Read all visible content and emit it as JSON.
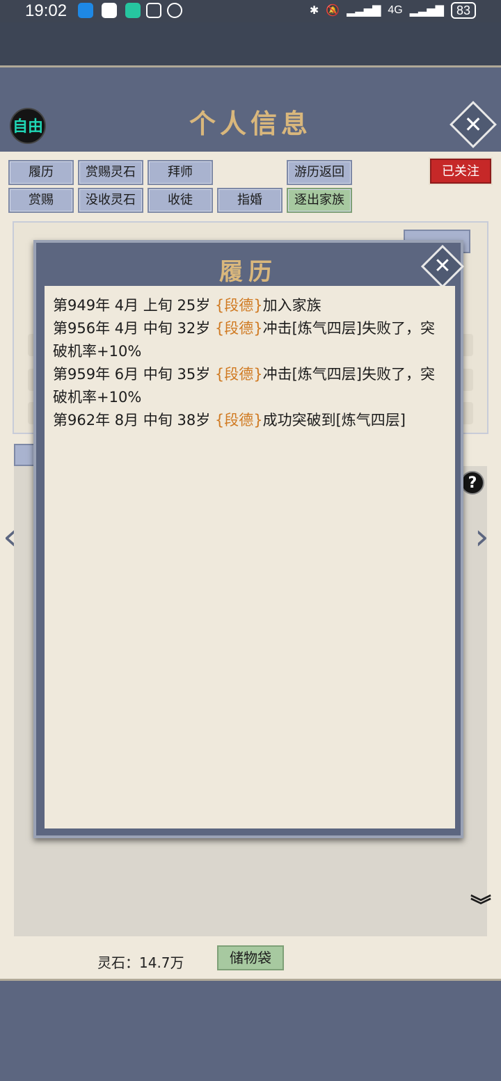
{
  "status_bar": {
    "time": "19:02",
    "network": "4G",
    "battery": "83"
  },
  "header": {
    "free_badge": "自由",
    "title": "个人信息"
  },
  "actions": {
    "row1": [
      "履历",
      "赏赐灵石",
      "拜师",
      "游历返回"
    ],
    "row2": [
      "赏赐",
      "没收灵石",
      "收徒",
      "指婚",
      "逐出家族"
    ],
    "followed": "已关注"
  },
  "bottom_bar": {
    "spirit_stone": "灵石：14.7万",
    "storage_bag": "储物袋"
  },
  "modal": {
    "title": "履历",
    "entries": [
      {
        "date": "第949年 4月 上旬  25岁 ",
        "name": "{段德}",
        "event": "加入家族"
      },
      {
        "date": "第956年 4月 中旬  32岁 ",
        "name": "{段德}",
        "event": "冲击[炼气四层]失败了，突破机率+10%"
      },
      {
        "date": "第959年 6月 中旬  35岁 ",
        "name": "{段德}",
        "event": "冲击[炼气四层]失败了，突破机率+10%"
      },
      {
        "date": "第962年 8月 中旬  38岁 ",
        "name": "{段德}",
        "event": "成功突破到[炼气四层]"
      }
    ]
  },
  "colors": {
    "header_blue": "#5c6680",
    "panel_bg": "#efe9dc",
    "title_gold": "#d9b77c",
    "name_orange": "#d07a22",
    "button_blue": "#a9b3cf",
    "button_green": "#a7c9a0",
    "followed_red": "#c62828"
  }
}
